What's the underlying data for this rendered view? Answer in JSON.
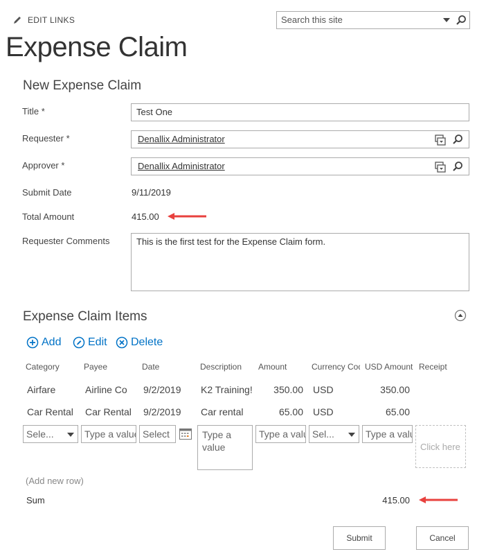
{
  "toolbar": {
    "edit_links": "EDIT LINKS"
  },
  "search": {
    "placeholder": "Search this site"
  },
  "page": {
    "title": "Expense Claim"
  },
  "form": {
    "section_title": "New Expense Claim",
    "title_label": "Title *",
    "title_value": "Test One",
    "requester_label": "Requester *",
    "requester_value": "Denallix Administrator",
    "approver_label": "Approver *",
    "approver_value": "Denallix Administrator",
    "submit_date_label": "Submit Date",
    "submit_date_value": "9/11/2019",
    "total_amount_label": "Total Amount",
    "total_amount_value": "415.00",
    "comments_label": "Requester Comments",
    "comments_value": "This is the first test for the Expense Claim form."
  },
  "items": {
    "section_title": "Expense Claim Items",
    "add_label": "Add",
    "edit_label": "Edit",
    "delete_label": "Delete",
    "columns": [
      "Category",
      "Payee",
      "Date",
      "Description",
      "Amount",
      "Currency Code",
      "USD Amount",
      "Receipt"
    ],
    "rows": [
      [
        "Airfare",
        "Airline Co",
        "9/2/2019",
        "K2 Training!",
        "350.00",
        "USD",
        "350.00",
        ""
      ],
      [
        "Car Rental",
        "Car Rental",
        "9/2/2019",
        "Car rental",
        "65.00",
        "USD",
        "65.00",
        ""
      ]
    ],
    "new_row": {
      "category": "Sele...",
      "payee": "Type a value",
      "date": "Select",
      "description": "Type a value",
      "amount": "Type a value",
      "currency": "Sel...",
      "usd_amount": "Type a value",
      "receipt": "Click here"
    },
    "add_new_row": "(Add new row)",
    "sum_label": "Sum",
    "sum_value": "415.00"
  },
  "buttons": {
    "submit": "Submit",
    "cancel": "Cancel"
  },
  "colors": {
    "accent": "#0072c6",
    "arrow": "#e8413e",
    "border": "#ababab"
  }
}
